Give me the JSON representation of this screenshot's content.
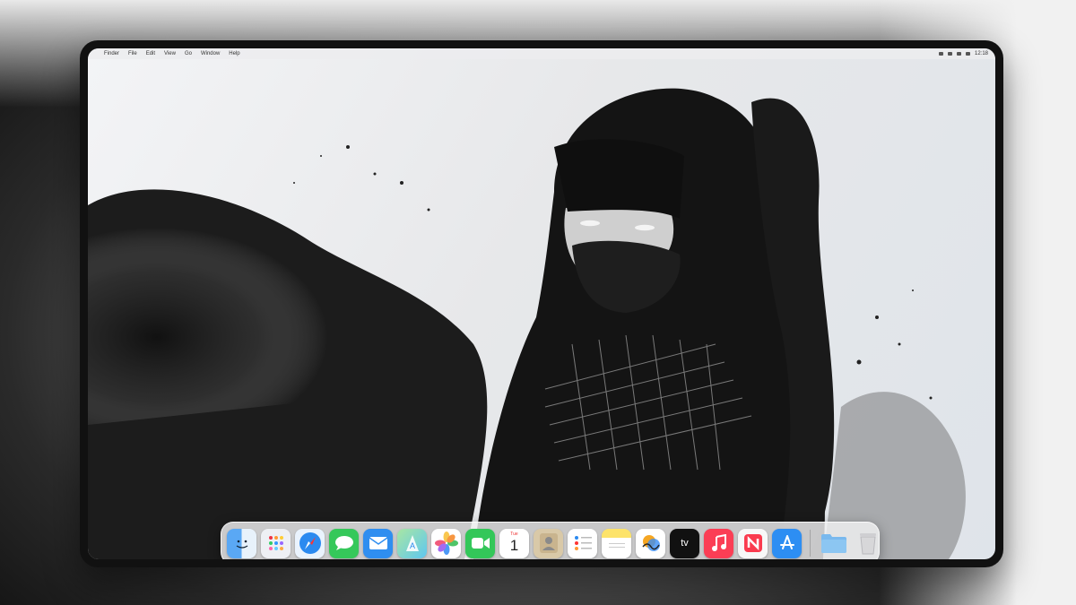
{
  "menubar": {
    "apple_glyph": "",
    "items": [
      "Finder",
      "File",
      "Edit",
      "View",
      "Go",
      "Window",
      "Help"
    ],
    "clock": "12:18"
  },
  "dock": {
    "apps": [
      {
        "name": "Finder",
        "icon": "finder-icon",
        "color": "#5aa8f4"
      },
      {
        "name": "Launchpad",
        "icon": "launchpad-icon",
        "color": "#eef0f4"
      },
      {
        "name": "Safari",
        "icon": "safari-icon",
        "color": "#eaf3fd"
      },
      {
        "name": "Messages",
        "icon": "messages-icon",
        "color": "#35c85a"
      },
      {
        "name": "Mail",
        "icon": "mail-icon",
        "color": "#2f8ef0"
      },
      {
        "name": "Maps",
        "icon": "maps-icon",
        "color": "#6fd37a"
      },
      {
        "name": "Photos",
        "icon": "photos-icon",
        "color": "#ffffff"
      },
      {
        "name": "FaceTime",
        "icon": "facetime-icon",
        "color": "#33c759"
      },
      {
        "name": "Calendar",
        "icon": "calendar-icon",
        "color": "#ffffff",
        "day": "Tue",
        "date": "1"
      },
      {
        "name": "Contacts",
        "icon": "contacts-icon",
        "color": "#d9c9a8"
      },
      {
        "name": "Reminders",
        "icon": "reminders-icon",
        "color": "#ffffff"
      },
      {
        "name": "Notes",
        "icon": "notes-icon",
        "color": "#fde36a"
      },
      {
        "name": "Freeform",
        "icon": "freeform-icon",
        "color": "#ffffff"
      },
      {
        "name": "TV",
        "icon": "tv-icon",
        "color": "#111111",
        "label": "tv"
      },
      {
        "name": "Music",
        "icon": "music-icon",
        "color": "#fb3e55"
      },
      {
        "name": "News",
        "icon": "news-icon",
        "color": "#f8f8f8"
      },
      {
        "name": "App Store",
        "icon": "appstore-icon",
        "color": "#2d8ef3"
      },
      {
        "name": "Downloads",
        "icon": "folder-icon",
        "color": "#79b9ee"
      },
      {
        "name": "Trash",
        "icon": "trash-icon",
        "color": "#d7d7d9"
      }
    ]
  }
}
